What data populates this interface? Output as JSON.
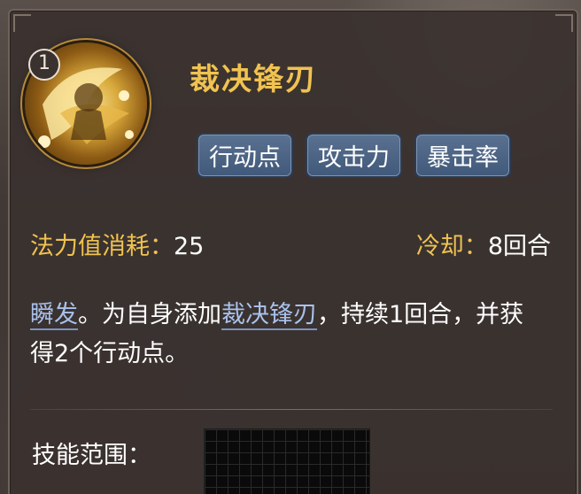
{
  "skill": {
    "rank": "1",
    "name": "裁决锋刃",
    "icon": "blade-sweep-icon",
    "tags": [
      "行动点",
      "攻击力",
      "暴击率"
    ]
  },
  "stats": {
    "cost_label": "法力值消耗：",
    "cost_value": "25",
    "cooldown_label": "冷却：",
    "cooldown_value": "8回合"
  },
  "description": {
    "keyword_instant": "瞬发",
    "part1": "。为自身添加",
    "keyword_buff": "裁决锋刃",
    "part2": "，持续1回合，并获得2个行动点。"
  },
  "range": {
    "label": "技能范围："
  },
  "colors": {
    "title_gold": "#f0c250",
    "keyword_blue": "#a9c2ee",
    "tag_blue": "#4a6486"
  }
}
